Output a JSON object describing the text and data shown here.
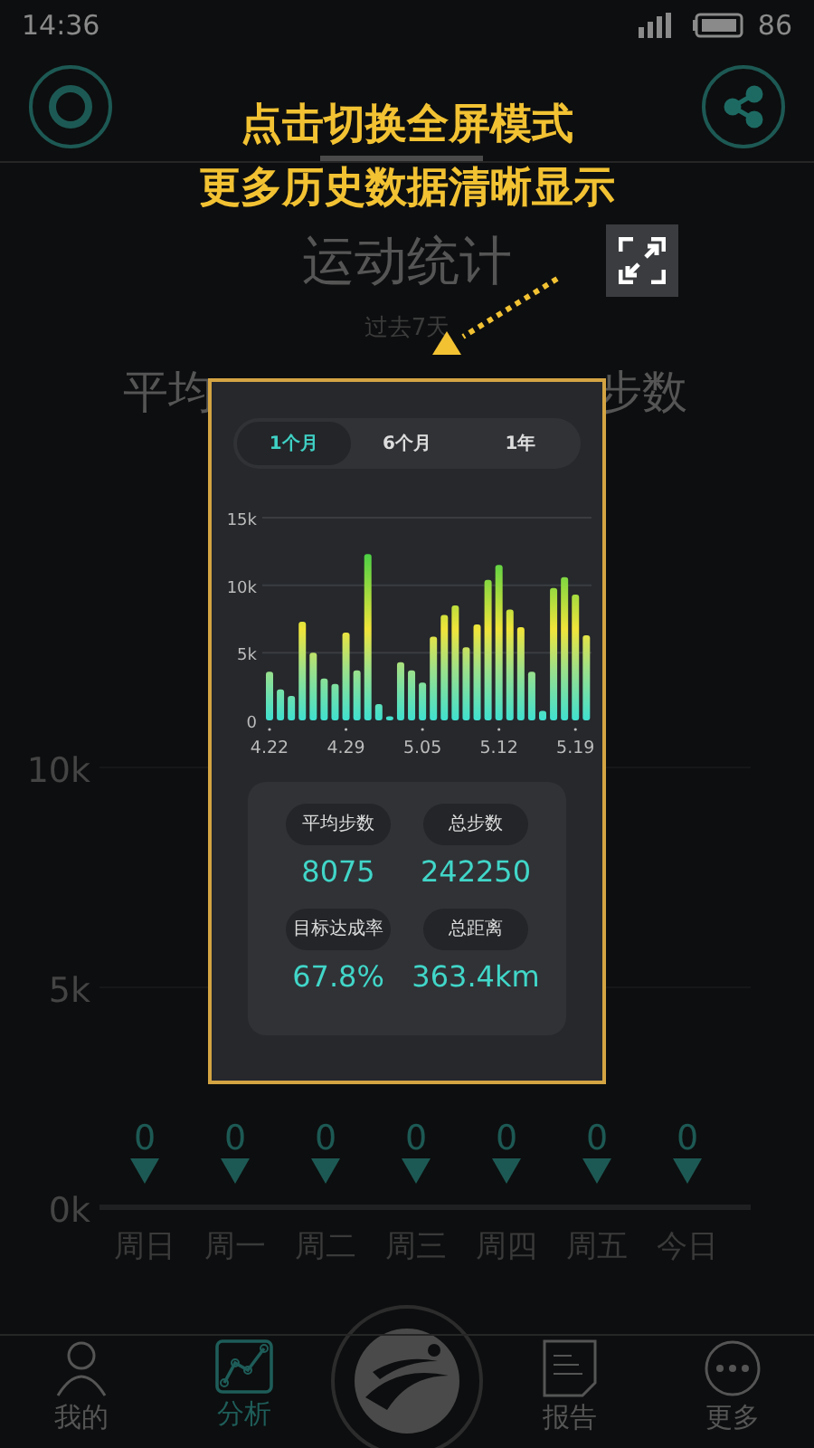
{
  "status_bar": {
    "time": "14:36",
    "battery": "86"
  },
  "hint": {
    "lines": [
      "点击切换全屏模式",
      "更多历史数据清晰显示"
    ]
  },
  "title": "运动统计",
  "period": "过去7天",
  "summary_labels": [
    "平均",
    "步数"
  ],
  "weekly_chart": {
    "chart_data": {
      "type": "bar",
      "categories": [
        "周日",
        "周一",
        "周二",
        "周三",
        "周四",
        "周五",
        "今日"
      ],
      "values": [
        0,
        0,
        0,
        0,
        0,
        0,
        0
      ],
      "data_labels": true,
      "ylim": [
        0,
        10000
      ],
      "yticks": [
        {
          "value": 0,
          "label": "0k"
        },
        {
          "value": 5000,
          "label": "5k"
        },
        {
          "value": 10000,
          "label": "10k"
        }
      ]
    }
  },
  "popup": {
    "ranges": [
      {
        "label": "1个月",
        "selected": true
      },
      {
        "label": "6个月",
        "selected": false
      },
      {
        "label": "1年",
        "selected": false
      }
    ],
    "chart_data": {
      "type": "bar",
      "categories": [
        "4.22",
        null,
        null,
        null,
        null,
        null,
        null,
        "4.29",
        null,
        null,
        null,
        null,
        null,
        null,
        "5.05",
        null,
        null,
        null,
        null,
        null,
        null,
        "5.12",
        null,
        null,
        null,
        null,
        null,
        null,
        "5.19",
        null
      ],
      "values": [
        3600,
        2300,
        1800,
        7300,
        5000,
        3100,
        2700,
        6500,
        3700,
        12300,
        1200,
        300,
        4300,
        3700,
        2800,
        6200,
        7800,
        8500,
        5400,
        7100,
        10400,
        11500,
        8200,
        6900,
        3600,
        700,
        9800,
        10600,
        9300,
        6300
      ],
      "yticks": [
        {
          "value": 0,
          "label": "0"
        },
        {
          "value": 5000,
          "label": "5k"
        },
        {
          "value": 10000,
          "label": "10k"
        },
        {
          "value": 15000,
          "label": "15k"
        }
      ],
      "ylim": [
        0,
        15000
      ]
    },
    "stats": [
      {
        "label": "平均步数",
        "value": "8075"
      },
      {
        "label": "总步数",
        "value": "242250"
      },
      {
        "label": "目标达成率",
        "value": "67.8%"
      },
      {
        "label": "总距离",
        "value": "363.4km"
      }
    ]
  },
  "bottom_nav": [
    {
      "kind": "tab",
      "label": "我的",
      "selected": false
    },
    {
      "kind": "tab",
      "label": "分析",
      "selected": true
    },
    {
      "kind": "logo"
    },
    {
      "kind": "tab",
      "label": "报告",
      "selected": false
    },
    {
      "kind": "tab",
      "label": "更多",
      "selected": false
    }
  ]
}
